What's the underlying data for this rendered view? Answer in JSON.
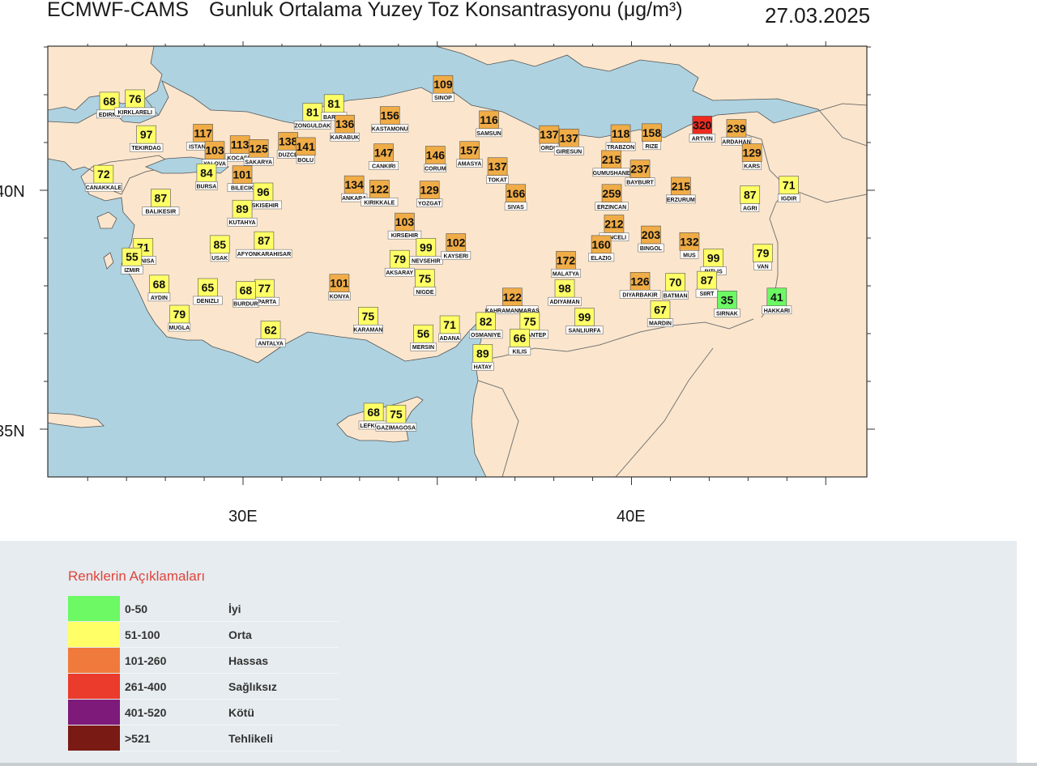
{
  "header": {
    "model": "ECMWF-CAMS",
    "title": "Gunluk Ortalama Yuzey Toz Konsantrasyonu (μg/m³)",
    "date": "27.03.2025"
  },
  "axes": {
    "lat_labels": [
      "40N",
      "35N"
    ],
    "lon_labels": [
      "30E",
      "40E"
    ]
  },
  "colors": {
    "sea": "#aed2e0",
    "land": "#fbe6cd",
    "good": "#6cf964",
    "moderate": "#ffff66",
    "sensitive": "#f0ac46",
    "unhealthy": "#ed2b1f"
  },
  "stations": [
    {
      "name": "EDIRNE",
      "value": 68,
      "lon": 26.56,
      "lat": 41.68,
      "cat": "moderate"
    },
    {
      "name": "KIRKLARELI",
      "value": 76,
      "lon": 27.22,
      "lat": 41.73,
      "cat": "moderate"
    },
    {
      "name": "TEKIRDAG",
      "value": 97,
      "lon": 27.51,
      "lat": 40.98,
      "cat": "moderate"
    },
    {
      "name": "ISTANBUL",
      "value": 117,
      "lon": 28.97,
      "lat": 41.01,
      "cat": "sensitive"
    },
    {
      "name": "KOCAELI",
      "value": 113,
      "lon": 29.92,
      "lat": 40.77,
      "cat": "sensitive"
    },
    {
      "name": "SAKARYA",
      "value": 125,
      "lon": 30.4,
      "lat": 40.69,
      "cat": "sensitive"
    },
    {
      "name": "YALOVA",
      "value": 103,
      "lon": 29.27,
      "lat": 40.65,
      "cat": "sensitive"
    },
    {
      "name": "DUZCE",
      "value": 138,
      "lon": 31.16,
      "lat": 40.84,
      "cat": "sensitive"
    },
    {
      "name": "BOLU",
      "value": 141,
      "lon": 31.61,
      "lat": 40.73,
      "cat": "sensitive"
    },
    {
      "name": "ZONGULDAK",
      "value": 81,
      "lon": 31.79,
      "lat": 41.45,
      "cat": "moderate"
    },
    {
      "name": "BARTIN",
      "value": 81,
      "lon": 32.34,
      "lat": 41.63,
      "cat": "moderate"
    },
    {
      "name": "KARABUK",
      "value": 136,
      "lon": 32.62,
      "lat": 41.2,
      "cat": "sensitive"
    },
    {
      "name": "KASTAMONU",
      "value": 156,
      "lon": 33.78,
      "lat": 41.38,
      "cat": "sensitive"
    },
    {
      "name": "SINOP",
      "value": 109,
      "lon": 35.15,
      "lat": 42.03,
      "cat": "sensitive"
    },
    {
      "name": "SAMSUN",
      "value": 116,
      "lon": 36.33,
      "lat": 41.29,
      "cat": "sensitive"
    },
    {
      "name": "ORDU",
      "value": 137,
      "lon": 37.88,
      "lat": 40.98,
      "cat": "sensitive"
    },
    {
      "name": "GIRESUN",
      "value": 137,
      "lon": 38.39,
      "lat": 40.91,
      "cat": "sensitive"
    },
    {
      "name": "TRABZON",
      "value": 118,
      "lon": 39.72,
      "lat": 41.0,
      "cat": "sensitive"
    },
    {
      "name": "RIZE",
      "value": 158,
      "lon": 40.52,
      "lat": 41.02,
      "cat": "sensitive"
    },
    {
      "name": "ARTVIN",
      "value": 320,
      "lon": 41.82,
      "lat": 41.18,
      "cat": "unhealthy"
    },
    {
      "name": "ARDAHAN",
      "value": 239,
      "lon": 42.7,
      "lat": 41.11,
      "cat": "sensitive"
    },
    {
      "name": "KARS",
      "value": 129,
      "lon": 43.1,
      "lat": 40.6,
      "cat": "sensitive"
    },
    {
      "name": "IGDIR",
      "value": 71,
      "lon": 44.05,
      "lat": 39.92,
      "cat": "moderate"
    },
    {
      "name": "CANAKKALE",
      "value": 72,
      "lon": 26.41,
      "lat": 40.15,
      "cat": "moderate"
    },
    {
      "name": "BURSA",
      "value": 84,
      "lon": 29.06,
      "lat": 40.18,
      "cat": "moderate"
    },
    {
      "name": "BILECIK",
      "value": 101,
      "lon": 29.98,
      "lat": 40.14,
      "cat": "sensitive"
    },
    {
      "name": "ESKISEHIR",
      "value": 96,
      "lon": 30.52,
      "lat": 39.78,
      "cat": "moderate"
    },
    {
      "name": "KUTAHYA",
      "value": 89,
      "lon": 29.98,
      "lat": 39.42,
      "cat": "moderate"
    },
    {
      "name": "BALIKESIR",
      "value": 87,
      "lon": 27.88,
      "lat": 39.65,
      "cat": "moderate"
    },
    {
      "name": "ANKARA",
      "value": 134,
      "lon": 32.86,
      "lat": 39.93,
      "cat": "sensitive"
    },
    {
      "name": "KIRIKKALE",
      "value": 122,
      "lon": 33.51,
      "lat": 39.84,
      "cat": "sensitive"
    },
    {
      "name": "CANKIRI",
      "value": 147,
      "lon": 33.62,
      "lat": 40.6,
      "cat": "sensitive"
    },
    {
      "name": "CORUM",
      "value": 146,
      "lon": 34.95,
      "lat": 40.55,
      "cat": "sensitive"
    },
    {
      "name": "AMASYA",
      "value": 157,
      "lon": 35.83,
      "lat": 40.65,
      "cat": "sensitive"
    },
    {
      "name": "TOKAT",
      "value": 137,
      "lon": 36.55,
      "lat": 40.31,
      "cat": "sensitive"
    },
    {
      "name": "YOZGAT",
      "value": 129,
      "lon": 34.8,
      "lat": 39.82,
      "cat": "sensitive"
    },
    {
      "name": "SIVAS",
      "value": 166,
      "lon": 37.02,
      "lat": 39.75,
      "cat": "sensitive"
    },
    {
      "name": "GUMUSHANE",
      "value": 215,
      "lon": 39.48,
      "lat": 40.46,
      "cat": "sensitive"
    },
    {
      "name": "BAYBURT",
      "value": 237,
      "lon": 40.22,
      "lat": 40.26,
      "cat": "sensitive"
    },
    {
      "name": "ERZURUM",
      "value": 215,
      "lon": 41.27,
      "lat": 39.9,
      "cat": "sensitive"
    },
    {
      "name": "AGRI",
      "value": 87,
      "lon": 43.05,
      "lat": 39.72,
      "cat": "moderate"
    },
    {
      "name": "ERZINCAN",
      "value": 259,
      "lon": 39.49,
      "lat": 39.75,
      "cat": "sensitive"
    },
    {
      "name": "TUNCELI",
      "value": 212,
      "lon": 39.55,
      "lat": 39.11,
      "cat": "sensitive"
    },
    {
      "name": "KIRSEHIR",
      "value": 103,
      "lon": 34.16,
      "lat": 39.15,
      "cat": "sensitive"
    },
    {
      "name": "NEVSEHIR",
      "value": 99,
      "lon": 34.71,
      "lat": 38.62,
      "cat": "moderate"
    },
    {
      "name": "KAYSERI",
      "value": 102,
      "lon": 35.48,
      "lat": 38.72,
      "cat": "sensitive"
    },
    {
      "name": "AKSARAY",
      "value": 79,
      "lon": 34.03,
      "lat": 38.37,
      "cat": "moderate"
    },
    {
      "name": "NIGDE",
      "value": 75,
      "lon": 34.68,
      "lat": 37.97,
      "cat": "moderate"
    },
    {
      "name": "BINGOL",
      "value": 203,
      "lon": 40.5,
      "lat": 38.88,
      "cat": "sensitive"
    },
    {
      "name": "MUS",
      "value": 132,
      "lon": 41.49,
      "lat": 38.74,
      "cat": "sensitive"
    },
    {
      "name": "ELAZIG",
      "value": 160,
      "lon": 39.22,
      "lat": 38.68,
      "cat": "sensitive"
    },
    {
      "name": "MALATYA",
      "value": 172,
      "lon": 38.31,
      "lat": 38.35,
      "cat": "sensitive"
    },
    {
      "name": "BITLIS",
      "value": 99,
      "lon": 42.11,
      "lat": 38.4,
      "cat": "moderate"
    },
    {
      "name": "VAN",
      "value": 79,
      "lon": 43.38,
      "lat": 38.5,
      "cat": "moderate"
    },
    {
      "name": "MANISA",
      "value": 71,
      "lon": 27.43,
      "lat": 38.62,
      "cat": "moderate"
    },
    {
      "name": "IZMIR",
      "value": 55,
      "lon": 27.14,
      "lat": 38.42,
      "cat": "moderate"
    },
    {
      "name": "USAK",
      "value": 85,
      "lon": 29.4,
      "lat": 38.68,
      "cat": "moderate"
    },
    {
      "name": "AFYONKARAHISAR",
      "value": 87,
      "lon": 30.54,
      "lat": 38.76,
      "cat": "moderate"
    },
    {
      "name": "AYDIN",
      "value": 68,
      "lon": 27.84,
      "lat": 37.85,
      "cat": "moderate"
    },
    {
      "name": "DENIZLI",
      "value": 65,
      "lon": 29.09,
      "lat": 37.78,
      "cat": "moderate"
    },
    {
      "name": "ISPARTA",
      "value": 77,
      "lon": 30.55,
      "lat": 37.76,
      "cat": "moderate"
    },
    {
      "name": "BURDUR",
      "value": 68,
      "lon": 30.07,
      "lat": 37.72,
      "cat": "moderate"
    },
    {
      "name": "KONYA",
      "value": 101,
      "lon": 32.48,
      "lat": 37.87,
      "cat": "sensitive"
    },
    {
      "name": "DIYARBAKIR",
      "value": 126,
      "lon": 40.22,
      "lat": 37.91,
      "cat": "sensitive"
    },
    {
      "name": "BATMAN",
      "value": 70,
      "lon": 41.13,
      "lat": 37.89,
      "cat": "moderate"
    },
    {
      "name": "SIIRT",
      "value": 87,
      "lon": 41.94,
      "lat": 37.93,
      "cat": "moderate"
    },
    {
      "name": "ADIYAMAN",
      "value": 98,
      "lon": 38.28,
      "lat": 37.76,
      "cat": "moderate"
    },
    {
      "name": "KAHRAMANMARAS",
      "value": 122,
      "lon": 36.93,
      "lat": 37.58,
      "cat": "sensitive"
    },
    {
      "name": "SIRNAK",
      "value": 35,
      "lon": 42.46,
      "lat": 37.52,
      "cat": "good"
    },
    {
      "name": "HAKKARI",
      "value": 41,
      "lon": 43.74,
      "lat": 37.58,
      "cat": "good"
    },
    {
      "name": "MARDIN",
      "value": 67,
      "lon": 40.74,
      "lat": 37.31,
      "cat": "moderate"
    },
    {
      "name": "MUGLA",
      "value": 79,
      "lon": 28.36,
      "lat": 37.22,
      "cat": "moderate"
    },
    {
      "name": "KARAMAN",
      "value": 75,
      "lon": 33.22,
      "lat": 37.18,
      "cat": "moderate"
    },
    {
      "name": "OSMANIYE",
      "value": 82,
      "lon": 36.25,
      "lat": 37.07,
      "cat": "moderate"
    },
    {
      "name": "GAZIANTEP",
      "value": 75,
      "lon": 37.38,
      "lat": 37.07,
      "cat": "moderate"
    },
    {
      "name": "SANLIURFA",
      "value": 99,
      "lon": 38.79,
      "lat": 37.16,
      "cat": "moderate"
    },
    {
      "name": "KILIS",
      "value": 66,
      "lon": 37.12,
      "lat": 36.72,
      "cat": "moderate"
    },
    {
      "name": "ADANA",
      "value": 71,
      "lon": 35.32,
      "lat": 37.0,
      "cat": "moderate"
    },
    {
      "name": "MERSIN",
      "value": 56,
      "lon": 34.64,
      "lat": 36.81,
      "cat": "moderate"
    },
    {
      "name": "ANTALYA",
      "value": 62,
      "lon": 30.71,
      "lat": 36.89,
      "cat": "moderate"
    },
    {
      "name": "HATAY",
      "value": 89,
      "lon": 36.17,
      "lat": 36.4,
      "cat": "moderate"
    },
    {
      "name": "LEFKOSA",
      "value": 68,
      "lon": 33.36,
      "lat": 35.17,
      "cat": "moderate"
    },
    {
      "name": "GAZIMAGOSA",
      "value": 75,
      "lon": 33.94,
      "lat": 35.13,
      "cat": "moderate"
    }
  ],
  "legend": {
    "title": "Renklerin Açıklamaları",
    "rows": [
      {
        "range": "0-50",
        "label": "İyi",
        "color": "#6cf964"
      },
      {
        "range": "51-100",
        "label": "Orta",
        "color": "#ffff66"
      },
      {
        "range": "101-260",
        "label": "Hassas",
        "color": "#f07a3c"
      },
      {
        "range": "261-400",
        "label": "Sağlıksız",
        "color": "#ea3b2d"
      },
      {
        "range": "401-520",
        "label": "Kötü",
        "color": "#7e1a7a"
      },
      {
        "range": ">521",
        "label": "Tehlikeli",
        "color": "#7a1a14"
      }
    ]
  }
}
